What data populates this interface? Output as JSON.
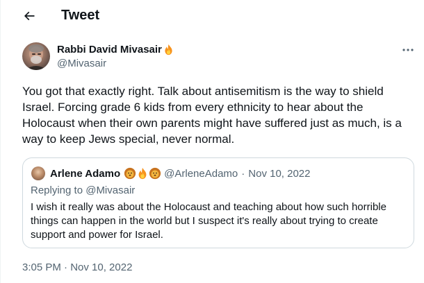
{
  "header": {
    "title": "Tweet",
    "back_icon": "arrow-left-icon"
  },
  "tweet": {
    "author_name": "Rabbi David Mivasair",
    "author_emoji": "fire-icon",
    "author_handle": "@Mivasair",
    "more_icon": "more-dots-icon",
    "text": "You got that exactly right.  Talk about antisemitism is the way to shield Israel.  Forcing grade 6 kids from every ethnicity to hear about the Holocaust when their own parents might have suffered just as much, is a way to keep Jews special, never normal.",
    "timestamp": "3:05 PM · Nov 10, 2022"
  },
  "quote": {
    "name": "Arlene Adamo",
    "emojis": [
      "lion-icon",
      "fire-icon",
      "lion-icon"
    ],
    "handle": "@ArleneAdamo",
    "separator": "·",
    "time": "Nov 10, 2022",
    "replying_to": "Replying to @Mivasair",
    "text": "I wish it really was about the Holocaust and teaching about how such horrible things can happen in the world but I suspect it's really about trying to create support and power for Israel."
  },
  "colors": {
    "text_primary": "#0f1419",
    "text_secondary": "#536471",
    "border": "#cfd9de"
  }
}
